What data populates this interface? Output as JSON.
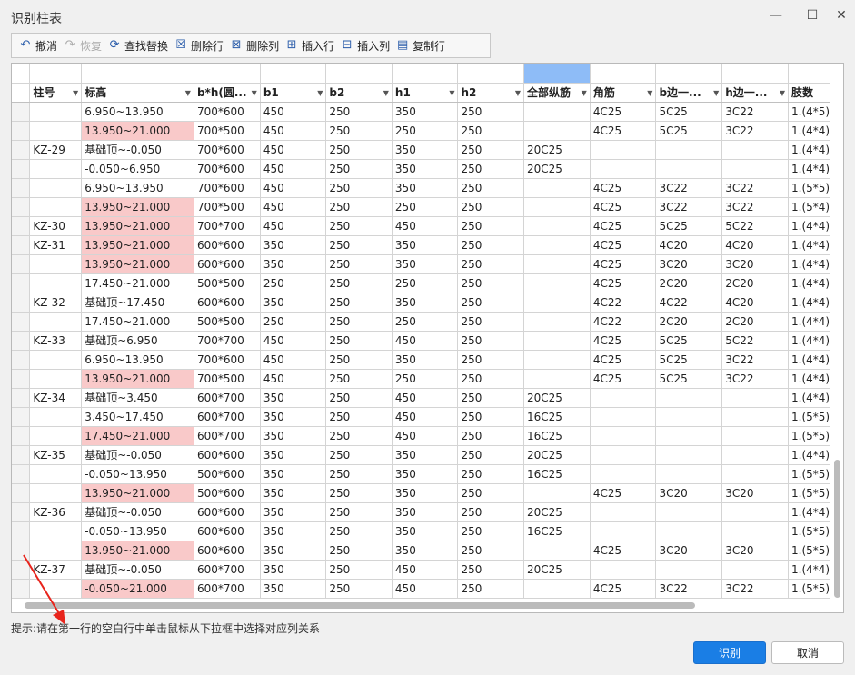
{
  "window": {
    "title": "识别柱表",
    "minimize": "—",
    "maximize": "☐",
    "close": "✕"
  },
  "toolbar": [
    {
      "name": "undo",
      "label": "撤消",
      "icon": "↶",
      "disabled": false
    },
    {
      "name": "redo",
      "label": "恢复",
      "icon": "↷",
      "disabled": true
    },
    {
      "name": "find-replace",
      "label": "查找替换",
      "icon": "⟳",
      "disabled": false
    },
    {
      "name": "delete-row",
      "label": "删除行",
      "icon": "☒",
      "disabled": false
    },
    {
      "name": "delete-col",
      "label": "删除列",
      "icon": "⊠",
      "disabled": false
    },
    {
      "name": "insert-row",
      "label": "插入行",
      "icon": "⊞",
      "disabled": false
    },
    {
      "name": "insert-col",
      "label": "插入列",
      "icon": "⊟",
      "disabled": false
    },
    {
      "name": "copy-row",
      "label": "复制行",
      "icon": "▤",
      "disabled": false
    }
  ],
  "table": {
    "headers": [
      "柱号",
      "标高",
      "b*h(圆...",
      "b1",
      "b2",
      "h1",
      "h2",
      "全部纵筋",
      "角筋",
      "b边一...",
      "h边一...",
      "肢数"
    ],
    "rows": [
      {
        "cells": [
          "",
          "6.950~13.950",
          "700*600",
          "450",
          "250",
          "350",
          "250",
          "",
          "4C25",
          "5C25",
          "3C22",
          "1.(4*5)"
        ],
        "pink": false
      },
      {
        "cells": [
          "",
          "13.950~21.000",
          "700*500",
          "450",
          "250",
          "250",
          "250",
          "",
          "4C25",
          "5C25",
          "3C22",
          "1.(4*4)"
        ],
        "pink": true
      },
      {
        "cells": [
          "KZ-29",
          "基础顶~-0.050",
          "700*600",
          "450",
          "250",
          "350",
          "250",
          "20C25",
          "",
          "",
          "",
          "1.(4*4)"
        ],
        "pink": false
      },
      {
        "cells": [
          "",
          "-0.050~6.950",
          "700*600",
          "450",
          "250",
          "350",
          "250",
          "20C25",
          "",
          "",
          "",
          "1.(4*4)"
        ],
        "pink": false
      },
      {
        "cells": [
          "",
          "6.950~13.950",
          "700*600",
          "450",
          "250",
          "350",
          "250",
          "",
          "4C25",
          "3C22",
          "3C22",
          "1.(5*5)"
        ],
        "pink": false
      },
      {
        "cells": [
          "",
          "13.950~21.000",
          "700*500",
          "450",
          "250",
          "250",
          "250",
          "",
          "4C25",
          "3C22",
          "3C22",
          "1.(5*4)"
        ],
        "pink": true
      },
      {
        "cells": [
          "KZ-30",
          "13.950~21.000",
          "700*700",
          "450",
          "250",
          "450",
          "250",
          "",
          "4C25",
          "5C25",
          "5C22",
          "1.(4*4)"
        ],
        "pink": true
      },
      {
        "cells": [
          "KZ-31",
          "13.950~21.000",
          "600*600",
          "350",
          "250",
          "350",
          "250",
          "",
          "4C25",
          "4C20",
          "4C20",
          "1.(4*4)"
        ],
        "pink": true
      },
      {
        "cells": [
          "",
          "13.950~21.000",
          "600*600",
          "350",
          "250",
          "350",
          "250",
          "",
          "4C25",
          "3C20",
          "3C20",
          "1.(4*4)"
        ],
        "pink": true
      },
      {
        "cells": [
          "",
          "17.450~21.000",
          "500*500",
          "250",
          "250",
          "250",
          "250",
          "",
          "4C25",
          "2C20",
          "2C20",
          "1.(4*4)"
        ],
        "pink": false
      },
      {
        "cells": [
          "KZ-32",
          "基础顶~17.450",
          "600*600",
          "350",
          "250",
          "350",
          "250",
          "",
          "4C22",
          "4C22",
          "4C20",
          "1.(4*4)"
        ],
        "pink": false
      },
      {
        "cells": [
          "",
          "17.450~21.000",
          "500*500",
          "250",
          "250",
          "250",
          "250",
          "",
          "4C22",
          "2C20",
          "2C20",
          "1.(4*4)"
        ],
        "pink": false
      },
      {
        "cells": [
          "KZ-33",
          "基础顶~6.950",
          "700*700",
          "450",
          "250",
          "450",
          "250",
          "",
          "4C25",
          "5C25",
          "5C22",
          "1.(4*4)"
        ],
        "pink": false
      },
      {
        "cells": [
          "",
          "6.950~13.950",
          "700*600",
          "450",
          "250",
          "350",
          "250",
          "",
          "4C25",
          "5C25",
          "3C22",
          "1.(4*4)"
        ],
        "pink": false
      },
      {
        "cells": [
          "",
          "13.950~21.000",
          "700*500",
          "450",
          "250",
          "250",
          "250",
          "",
          "4C25",
          "5C25",
          "3C22",
          "1.(4*4)"
        ],
        "pink": true
      },
      {
        "cells": [
          "KZ-34",
          "基础顶~3.450",
          "600*700",
          "350",
          "250",
          "450",
          "250",
          "20C25",
          "",
          "",
          "",
          "1.(4*4)"
        ],
        "pink": false
      },
      {
        "cells": [
          "",
          "3.450~17.450",
          "600*700",
          "350",
          "250",
          "450",
          "250",
          "16C25",
          "",
          "",
          "",
          "1.(5*5)"
        ],
        "pink": false
      },
      {
        "cells": [
          "",
          "17.450~21.000",
          "600*700",
          "350",
          "250",
          "450",
          "250",
          "16C25",
          "",
          "",
          "",
          "1.(5*5)"
        ],
        "pink": true
      },
      {
        "cells": [
          "KZ-35",
          "基础顶~-0.050",
          "600*600",
          "350",
          "250",
          "350",
          "250",
          "20C25",
          "",
          "",
          "",
          "1.(4*4)"
        ],
        "pink": false
      },
      {
        "cells": [
          "",
          "-0.050~13.950",
          "500*600",
          "350",
          "250",
          "350",
          "250",
          "16C25",
          "",
          "",
          "",
          "1.(5*5)"
        ],
        "pink": false
      },
      {
        "cells": [
          "",
          "13.950~21.000",
          "500*600",
          "350",
          "250",
          "350",
          "250",
          "",
          "4C25",
          "3C20",
          "3C20",
          "1.(5*5)"
        ],
        "pink": true
      },
      {
        "cells": [
          "KZ-36",
          "基础顶~-0.050",
          "600*600",
          "350",
          "250",
          "350",
          "250",
          "20C25",
          "",
          "",
          "",
          "1.(4*4)"
        ],
        "pink": false
      },
      {
        "cells": [
          "",
          "-0.050~13.950",
          "600*600",
          "350",
          "250",
          "350",
          "250",
          "16C25",
          "",
          "",
          "",
          "1.(5*5)"
        ],
        "pink": false
      },
      {
        "cells": [
          "",
          "13.950~21.000",
          "600*600",
          "350",
          "250",
          "350",
          "250",
          "",
          "4C25",
          "3C20",
          "3C20",
          "1.(5*5)"
        ],
        "pink": true
      },
      {
        "cells": [
          "KZ-37",
          "基础顶~-0.050",
          "600*700",
          "350",
          "250",
          "450",
          "250",
          "20C25",
          "",
          "",
          "",
          "1.(4*4)"
        ],
        "pink": false
      },
      {
        "cells": [
          "",
          "-0.050~21.000",
          "600*700",
          "350",
          "250",
          "450",
          "250",
          "",
          "4C25",
          "3C22",
          "3C22",
          "1.(5*5)"
        ],
        "pink": true
      }
    ]
  },
  "status": {
    "hint": "提示:请在第一行的空白行中单击鼠标从下拉框中选择对应列关系"
  },
  "buttons": {
    "ok": "识别",
    "cancel": "取消"
  },
  "colors": {
    "pink_cell": "#f9c9c9",
    "selected_header": "#8ebcf7",
    "primary": "#1a7ee5",
    "annotation_arrow": "#e8241c"
  }
}
